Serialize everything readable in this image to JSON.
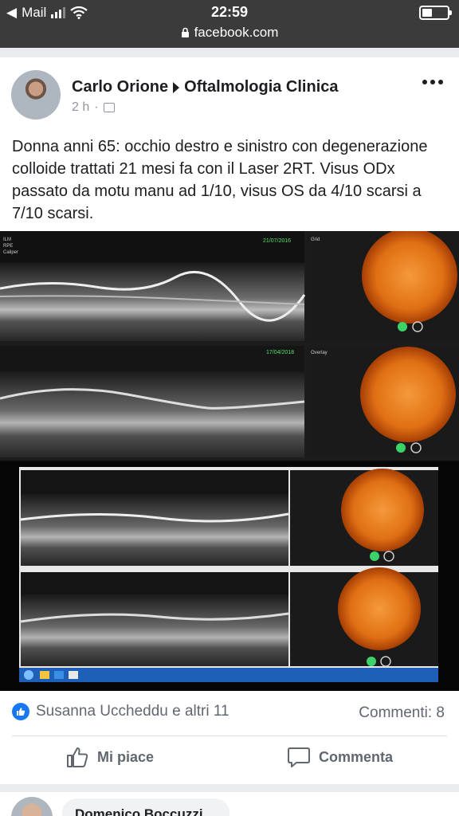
{
  "status_bar": {
    "carrier": "Mail",
    "time": "22:59",
    "url": "facebook.com"
  },
  "post": {
    "author": "Carlo Orione",
    "group": "Oftalmologia Clinica",
    "time": "2 h",
    "text": "Donna anni 65: occhio destro e sinistro con degenerazione colloide trattati 21 mesi fa con il Laser 2RT. Visus ODx passato da motu manu ad 1/10, visus OS da 4/10 scarsi a 7/10 scarsi.",
    "image_text": {
      "date_1": "21/07/2016",
      "date_2": "17/04/2018",
      "grid": "Grid",
      "overlay": "Overlay",
      "layer_1": "ILM",
      "layer_2": "RPE",
      "layer_3": "Caliper"
    },
    "reactions_text": "Susanna Uccheddu e altri 11",
    "comments_text": "Commenti: 8",
    "like_label": "Mi piace",
    "comment_label": "Commenta"
  },
  "comment_preview": {
    "author": "Domenico Boccuzzi"
  },
  "colors": {
    "facebook_blue": "#1877f2",
    "fundus_orange": "#d96a18"
  }
}
